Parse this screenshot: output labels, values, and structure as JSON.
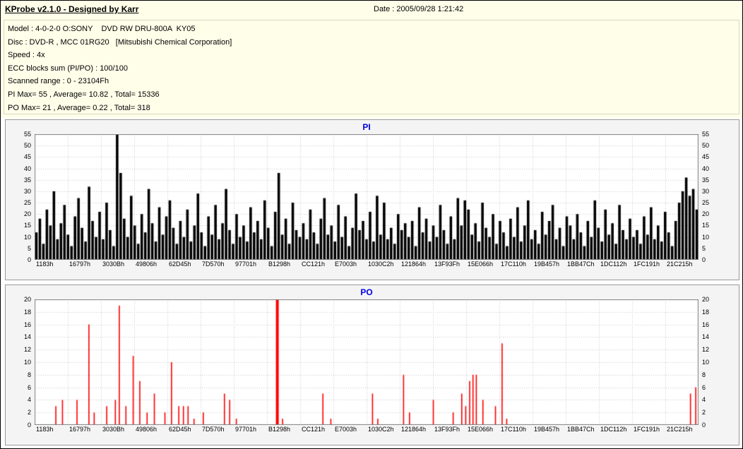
{
  "header": {
    "app_title": "KProbe v2.1.0 - Designed by Karr",
    "date": "Date : 2005/09/28 1:21:42"
  },
  "info": {
    "model": "Model : 4-0-2-0 O:SONY    DVD RW DRU-800A  KY05",
    "disc": "Disc : DVD-R , MCC 01RG20   [Mitsubishi Chemical Corporation]",
    "speed": "Speed : 4x",
    "ecc": "ECC blocks sum (PI/PO) : 100/100",
    "range": "Scanned range : 0 - 23104Fh",
    "pi_stats": "PI Max= 55 , Average= 10.82 , Total= 15336",
    "po_stats": "PO Max= 21 , Average= 0.22 , Total= 318"
  },
  "colors": {
    "background": "#FEFEE9",
    "panel": "#F4F4F4",
    "plot_bg": "#FFFFFF",
    "grid": "#C9C9C9",
    "plot_border": "#7F7F7F",
    "pi_bar": "#000000",
    "po_bar": "#FF0000",
    "title_blue": "#0000E0"
  },
  "chart_data": [
    {
      "type": "bar",
      "title": "PI",
      "ylabel": "",
      "xlabel": "",
      "ylim": [
        0,
        55
      ],
      "yticks": [
        0,
        5,
        10,
        15,
        20,
        25,
        30,
        35,
        40,
        45,
        50,
        55
      ],
      "grid": true,
      "color": "#000000",
      "stats": {
        "max": 55,
        "average": 10.82,
        "total": 15336
      },
      "categories": [
        "1183h",
        "16797h",
        "3030Bh",
        "49806h",
        "62D45h",
        "7D570h",
        "97701h",
        "B1298h",
        "CC121h",
        "E7003h",
        "1030C2h",
        "121864h",
        "13F93Fh",
        "15E066h",
        "17C110h",
        "19B457h",
        "1BB47Ch",
        "1DC112h",
        "1FC191h",
        "21C215h"
      ],
      "values": [
        12,
        18,
        7,
        22,
        15,
        30,
        9,
        16,
        24,
        11,
        6,
        19,
        27,
        14,
        8,
        32,
        17,
        10,
        21,
        9,
        25,
        13,
        6,
        55,
        38,
        18,
        10,
        28,
        15,
        7,
        20,
        12,
        31,
        16,
        8,
        23,
        11,
        19,
        26,
        14,
        7,
        17,
        10,
        22,
        8,
        15,
        29,
        12,
        6,
        19,
        11,
        24,
        9,
        16,
        31,
        13,
        7,
        20,
        10,
        15,
        8,
        23,
        12,
        17,
        9,
        26,
        14,
        6,
        21,
        38,
        11,
        18,
        7,
        25,
        13,
        10,
        16,
        9,
        22,
        12,
        7,
        18,
        27,
        11,
        15,
        8,
        24,
        10,
        19,
        6,
        14,
        29,
        13,
        17,
        9,
        21,
        8,
        28,
        11,
        25,
        9,
        14,
        7,
        20,
        13,
        16,
        10,
        17,
        6,
        23,
        12,
        18,
        8,
        15,
        10,
        24,
        13,
        7,
        19,
        9,
        27,
        15,
        26,
        22,
        11,
        16,
        8,
        25,
        14,
        10,
        20,
        7,
        17,
        12,
        6,
        18,
        10,
        23,
        8,
        15,
        26,
        9,
        13,
        7,
        21,
        11,
        17,
        24,
        9,
        14,
        6,
        19,
        15,
        9,
        20,
        12,
        6,
        17,
        10,
        26,
        14,
        8,
        22,
        11,
        16,
        7,
        24,
        13,
        9,
        18,
        10,
        13,
        7,
        19,
        11,
        23,
        9,
        15,
        8,
        21,
        12,
        6,
        17,
        25,
        30,
        36,
        28,
        31,
        22
      ]
    },
    {
      "type": "bar",
      "title": "PO",
      "ylabel": "",
      "xlabel": "",
      "ylim": [
        0,
        20
      ],
      "yticks": [
        0,
        2,
        4,
        6,
        8,
        10,
        12,
        14,
        16,
        18,
        20
      ],
      "grid": true,
      "color": "#FF0000",
      "stats": {
        "max": 21,
        "average": 0.22,
        "total": 318
      },
      "categories": [
        "1183h",
        "16797h",
        "3030Bh",
        "49806h",
        "62D45h",
        "7D570h",
        "97701h",
        "B1298h",
        "CC121h",
        "E7003h",
        "1030C2h",
        "121864h",
        "13F93Fh",
        "15E066h",
        "17C110h",
        "19B457h",
        "1BB47Ch",
        "1DC112h",
        "1FC191h",
        "21C215h"
      ],
      "spikes": [
        [
          0.03,
          3
        ],
        [
          0.04,
          4
        ],
        [
          0.062,
          4
        ],
        [
          0.08,
          16
        ],
        [
          0.088,
          2
        ],
        [
          0.107,
          3
        ],
        [
          0.12,
          4
        ],
        [
          0.126,
          19
        ],
        [
          0.136,
          3
        ],
        [
          0.147,
          11
        ],
        [
          0.157,
          7
        ],
        [
          0.168,
          2
        ],
        [
          0.179,
          5
        ],
        [
          0.195,
          2
        ],
        [
          0.205,
          10
        ],
        [
          0.216,
          3
        ],
        [
          0.223,
          3
        ],
        [
          0.23,
          3
        ],
        [
          0.239,
          1
        ],
        [
          0.253,
          2
        ],
        [
          0.285,
          5
        ],
        [
          0.293,
          4
        ],
        [
          0.303,
          1
        ],
        [
          0.365,
          21
        ],
        [
          0.373,
          1
        ],
        [
          0.434,
          5
        ],
        [
          0.446,
          1
        ],
        [
          0.509,
          5
        ],
        [
          0.517,
          1
        ],
        [
          0.556,
          8
        ],
        [
          0.565,
          2
        ],
        [
          0.601,
          4
        ],
        [
          0.631,
          2
        ],
        [
          0.644,
          5
        ],
        [
          0.65,
          3
        ],
        [
          0.656,
          7
        ],
        [
          0.661,
          8
        ],
        [
          0.666,
          8
        ],
        [
          0.676,
          4
        ],
        [
          0.695,
          3
        ],
        [
          0.705,
          13
        ],
        [
          0.712,
          1
        ],
        [
          0.99,
          5
        ],
        [
          0.998,
          6
        ]
      ]
    }
  ]
}
